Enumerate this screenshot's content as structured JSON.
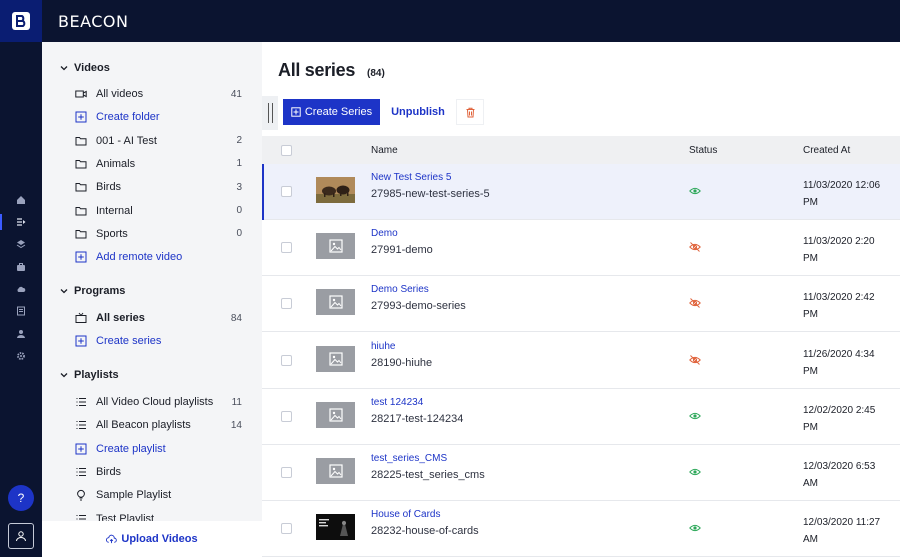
{
  "app": {
    "brand": "BEACON"
  },
  "colors": {
    "accent": "#1d34c7",
    "nav_bg": "#0b1430",
    "status_on": "#2ea85a",
    "status_off": "#e0623a"
  },
  "rail": {
    "icons": [
      "home-icon",
      "programs-icon",
      "layers-icon",
      "briefcase-icon",
      "cloud-icon",
      "document-icon",
      "user-icon",
      "gear-icon"
    ],
    "help_label": "?"
  },
  "sidebar": {
    "videos": {
      "title": "Videos",
      "items": [
        {
          "label": "All videos",
          "count": "41",
          "icon": "video-icon"
        },
        {
          "label": "Create folder",
          "count": "",
          "icon": "plus-box-icon"
        },
        {
          "label": "001 - AI Test",
          "count": "2",
          "icon": "folder-icon"
        },
        {
          "label": "Animals",
          "count": "1",
          "icon": "folder-icon"
        },
        {
          "label": "Birds",
          "count": "3",
          "icon": "folder-icon"
        },
        {
          "label": "Internal",
          "count": "0",
          "icon": "folder-icon"
        },
        {
          "label": "Sports",
          "count": "0",
          "icon": "folder-icon"
        },
        {
          "label": "Add remote video",
          "count": "",
          "icon": "plus-box-icon"
        }
      ]
    },
    "programs": {
      "title": "Programs",
      "items": [
        {
          "label": "All series",
          "count": "84",
          "icon": "tv-icon"
        },
        {
          "label": "Create series",
          "count": "",
          "icon": "plus-box-icon"
        }
      ]
    },
    "playlists": {
      "title": "Playlists",
      "items": [
        {
          "label": "All Video Cloud playlists",
          "count": "11",
          "icon": "list-icon"
        },
        {
          "label": "All Beacon playlists",
          "count": "14",
          "icon": "list-icon"
        },
        {
          "label": "Create playlist",
          "count": "",
          "icon": "plus-box-icon"
        },
        {
          "label": "Birds",
          "count": "",
          "icon": "list-icon"
        },
        {
          "label": "Sample Playlist",
          "count": "",
          "icon": "bulb-icon"
        },
        {
          "label": "Test Playlist",
          "count": "",
          "icon": "list-icon"
        }
      ]
    },
    "upload_label": "Upload Videos"
  },
  "main": {
    "title": "All series",
    "count": "(84)",
    "toolbar": {
      "create_label": "Create Series",
      "unpublish_label": "Unpublish"
    },
    "columns": {
      "name": "Name",
      "status": "Status",
      "created": "Created At"
    },
    "rows": [
      {
        "name": "New Test Series 5",
        "slug": "27985-new-test-series-5",
        "status": "visible",
        "date_line1": "11/03/2020 12:06",
        "date_line2": "PM",
        "thumb": "bison"
      },
      {
        "name": "Demo",
        "slug": "27991-demo",
        "status": "hidden",
        "date_line1": "11/03/2020 2:20",
        "date_line2": "PM",
        "thumb": "placeholder"
      },
      {
        "name": "Demo Series",
        "slug": "27993-demo-series",
        "status": "hidden",
        "date_line1": "11/03/2020 2:42",
        "date_line2": "PM",
        "thumb": "placeholder"
      },
      {
        "name": "hiuhe",
        "slug": "28190-hiuhe",
        "status": "hidden",
        "date_line1": "11/26/2020 4:34",
        "date_line2": "PM",
        "thumb": "placeholder"
      },
      {
        "name": "test 124234",
        "slug": "28217-test-124234",
        "status": "visible",
        "date_line1": "12/02/2020 2:45",
        "date_line2": "PM",
        "thumb": "placeholder"
      },
      {
        "name": "test_series_CMS",
        "slug": "28225-test_series_cms",
        "status": "visible",
        "date_line1": "12/03/2020 6:53",
        "date_line2": "AM",
        "thumb": "placeholder"
      },
      {
        "name": "House of Cards",
        "slug": "28232-house-of-cards",
        "status": "visible",
        "date_line1": "12/03/2020 11:27",
        "date_line2": "AM",
        "thumb": "cards"
      }
    ]
  }
}
